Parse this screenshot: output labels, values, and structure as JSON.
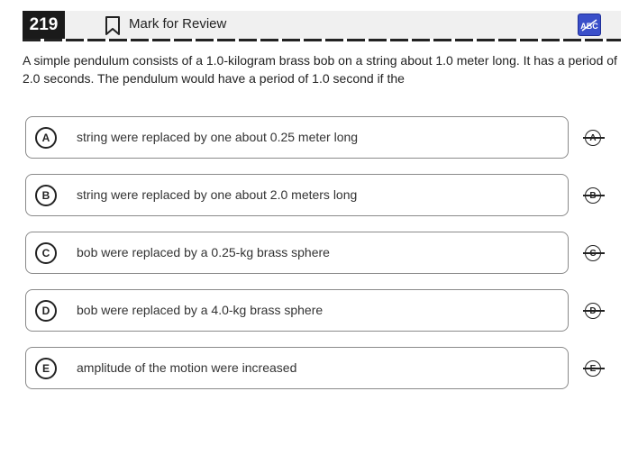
{
  "header": {
    "question_number": "219",
    "mark_for_review_label": "Mark for Review",
    "abc_label": "ABC"
  },
  "question": {
    "text": "A simple pendulum consists of a 1.0-kilogram brass bob on a string about 1.0 meter long. It has a period of 2.0 seconds. The pendulum would have a period of 1.0 second if the"
  },
  "choices": [
    {
      "letter": "A",
      "text": "string were replaced by one about 0.25 meter long"
    },
    {
      "letter": "B",
      "text": "string were replaced by one about 2.0 meters long"
    },
    {
      "letter": "C",
      "text": "bob were replaced by a 0.25-kg brass sphere"
    },
    {
      "letter": "D",
      "text": "bob were replaced by a 4.0-kg brass sphere"
    },
    {
      "letter": "E",
      "text": "amplitude of the motion were increased"
    }
  ],
  "colors": {
    "question_number_bg": "#1a1a1a",
    "header_bg": "#f0f0f0",
    "abc_button_bg": "#3a4fc9"
  }
}
